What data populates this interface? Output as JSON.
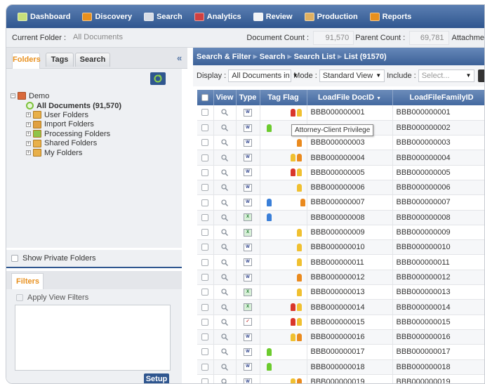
{
  "nav": {
    "items": [
      {
        "label": "Dashboard",
        "icon": "dashboard-icon",
        "color": "#c7e07a"
      },
      {
        "label": "Discovery",
        "icon": "discovery-icon",
        "color": "#e8901e"
      },
      {
        "label": "Search",
        "icon": "search-icon",
        "color": "#d8dde6"
      },
      {
        "label": "Analytics",
        "icon": "analytics-icon",
        "color": "#d04040"
      },
      {
        "label": "Review",
        "icon": "review-icon",
        "color": "#f1f3f6"
      },
      {
        "label": "Production",
        "icon": "production-icon",
        "color": "#e0b060"
      },
      {
        "label": "Reports",
        "icon": "reports-icon",
        "color": "#e8901e"
      }
    ]
  },
  "info": {
    "current_folder_label": "Current Folder :",
    "current_folder_value": "All Documents",
    "document_count_label": "Document Count :",
    "document_count_value": "91,570",
    "parent_count_label": "Parent Count :",
    "parent_count_value": "69,781",
    "attachment_label": "Attachme"
  },
  "left": {
    "tabs": [
      "Folders",
      "Tags",
      "Search"
    ],
    "collapse": "«",
    "tree": {
      "root": "Demo",
      "all_docs": "All Documents (91,570)",
      "children": [
        "User Folders",
        "Import Folders",
        "Processing Folders",
        "Shared Folders",
        "My Folders"
      ]
    },
    "show_private": "Show Private Folders",
    "filters_tab": "Filters",
    "apply_view_filters": "Apply View Filters",
    "setup": "Setup"
  },
  "right": {
    "breadcrumb": [
      "Search & Filter",
      "Search",
      "Search List",
      "List (91570)"
    ],
    "display_label": "Display :",
    "display_value": "All Documents in",
    "mode_label": "Mode :",
    "mode_value": "Standard View",
    "include_label": "Include :",
    "include_placeholder": "Select..."
  },
  "table": {
    "columns": [
      "",
      "View",
      "Type",
      "Tag Flag",
      "LoadFile DocID",
      "LoadFileFamilyID"
    ],
    "rows": [
      {
        "type": "word",
        "flags": [
          "red",
          "yellow"
        ],
        "docid": "BBB000000001",
        "familyid": "BBB000000001"
      },
      {
        "type": "word",
        "flags": [
          "green"
        ],
        "docid": "BBB000000002",
        "familyid": "BBB000000002"
      },
      {
        "type": "word",
        "flags": [
          "orange"
        ],
        "docid": "BBB000000003",
        "familyid": "BBB000000003"
      },
      {
        "type": "word",
        "flags": [
          "yellow",
          "orange"
        ],
        "docid": "BBB000000004",
        "familyid": "BBB000000004"
      },
      {
        "type": "word",
        "flags": [
          "red",
          "yellow"
        ],
        "docid": "BBB000000005",
        "familyid": "BBB000000005"
      },
      {
        "type": "word",
        "flags": [
          "yellow"
        ],
        "docid": "BBB000000006",
        "familyid": "BBB000000006"
      },
      {
        "type": "word",
        "flags": [
          "blue",
          "orange"
        ],
        "docid": "BBB000000007",
        "familyid": "BBB000000007"
      },
      {
        "type": "excel",
        "flags": [
          "blue"
        ],
        "docid": "BBB000000008",
        "familyid": "BBB000000008"
      },
      {
        "type": "excel",
        "flags": [
          "yellow"
        ],
        "docid": "BBB000000009",
        "familyid": "BBB000000009"
      },
      {
        "type": "word",
        "flags": [
          "yellow"
        ],
        "docid": "BBB000000010",
        "familyid": "BBB000000010"
      },
      {
        "type": "word",
        "flags": [
          "yellow"
        ],
        "docid": "BBB000000011",
        "familyid": "BBB000000011"
      },
      {
        "type": "word",
        "flags": [
          "orange"
        ],
        "docid": "BBB000000012",
        "familyid": "BBB000000012"
      },
      {
        "type": "excel",
        "flags": [
          "yellow"
        ],
        "docid": "BBB000000013",
        "familyid": "BBB000000013"
      },
      {
        "type": "excel",
        "flags": [
          "red",
          "yellow"
        ],
        "docid": "BBB000000014",
        "familyid": "BBB000000014"
      },
      {
        "type": "pdf",
        "flags": [
          "red",
          "yellow"
        ],
        "docid": "BBB000000015",
        "familyid": "BBB000000015"
      },
      {
        "type": "word",
        "flags": [
          "yellow",
          "orange"
        ],
        "docid": "BBB000000016",
        "familyid": "BBB000000016"
      },
      {
        "type": "word",
        "flags": [
          "green"
        ],
        "docid": "BBB000000017",
        "familyid": "BBB000000017"
      },
      {
        "type": "word",
        "flags": [
          "green"
        ],
        "docid": "BBB000000018",
        "familyid": "BBB000000018"
      },
      {
        "type": "word",
        "flags": [
          "yellow",
          "orange"
        ],
        "docid": "BBB000000019",
        "familyid": "BBB000000019"
      }
    ]
  },
  "tooltip": "Attorney-Client Privilege",
  "colors": {
    "red": "#d9362b",
    "yellow": "#f0c030",
    "orange": "#ea8a1e",
    "green": "#6ccb2e",
    "blue": "#3a7fd8",
    "accent_orange": "#e8901e",
    "nav_blue": "#2f568f"
  }
}
